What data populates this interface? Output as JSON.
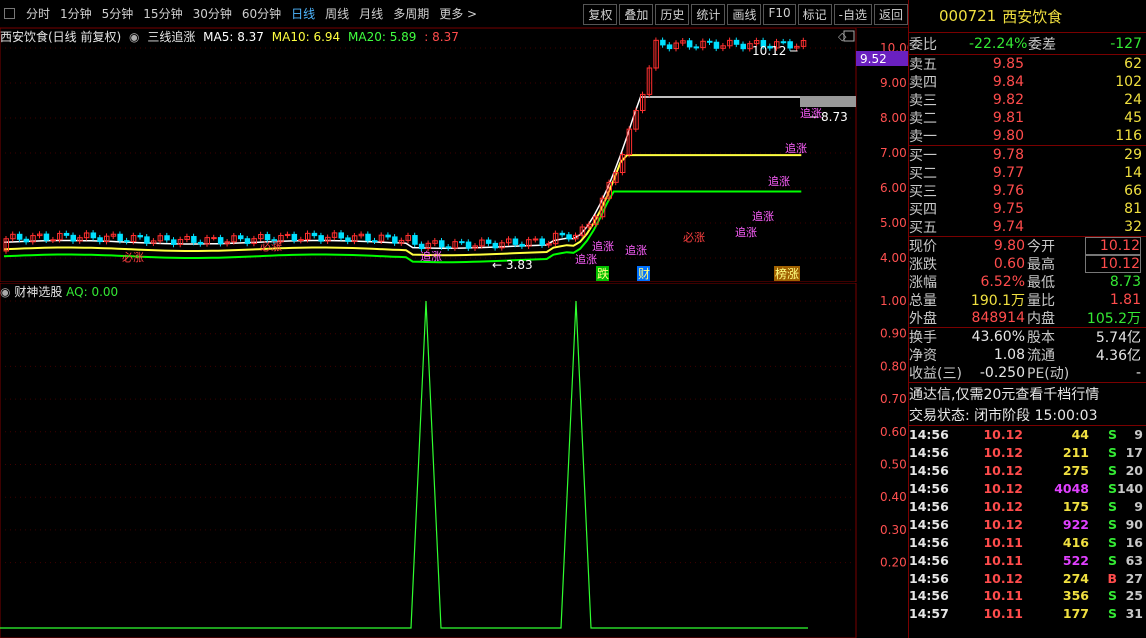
{
  "topbar": {
    "periods": [
      "分时",
      "1分钟",
      "5分钟",
      "15分钟",
      "30分钟",
      "60分钟",
      "日线",
      "周线",
      "月线",
      "多周期",
      "更多"
    ],
    "active": "日线",
    "buttons": [
      "复权",
      "叠加",
      "历史",
      "统计",
      "画线",
      "F10",
      "标记",
      "-自选",
      "返回"
    ]
  },
  "kline_header": {
    "stock": "西安饮食(日线 前复权)",
    "formula": "三线追涨",
    "ma5": "MA5: 8.37",
    "ma10": "MA10: 6.94",
    "ma20": "MA20: 5.89",
    "extra": ": 8.37"
  },
  "price_axis": [
    "10.00",
    "9.00",
    "8.00",
    "7.00",
    "6.00",
    "5.00",
    "4.00"
  ],
  "annotations": {
    "high": "10.12",
    "low": "3.83",
    "last": "8.73",
    "cursor_price": "9.52",
    "signal": "追涨",
    "signal2": "必涨",
    "markers": [
      "跌",
      "财",
      "榜涨"
    ]
  },
  "indicator_header": {
    "name": "财神选股",
    "value": "AQ: 0.00"
  },
  "indicator_axis": [
    "1.00",
    "0.90",
    "0.80",
    "0.70",
    "0.60",
    "0.50",
    "0.40",
    "0.30",
    "0.20"
  ],
  "quote": {
    "code": "000721",
    "name": "西安饮食",
    "weibi_label": "委比",
    "weibi": "-22.24%",
    "weicha_label": "委差",
    "weicha": "-127",
    "asks": [
      {
        "label": "卖五",
        "price": "9.85",
        "vol": "62"
      },
      {
        "label": "卖四",
        "price": "9.84",
        "vol": "102"
      },
      {
        "label": "卖三",
        "price": "9.82",
        "vol": "24"
      },
      {
        "label": "卖二",
        "price": "9.81",
        "vol": "45"
      },
      {
        "label": "卖一",
        "price": "9.80",
        "vol": "116"
      }
    ],
    "bids": [
      {
        "label": "买一",
        "price": "9.78",
        "vol": "29"
      },
      {
        "label": "买二",
        "price": "9.77",
        "vol": "14"
      },
      {
        "label": "买三",
        "price": "9.76",
        "vol": "66"
      },
      {
        "label": "买四",
        "price": "9.75",
        "vol": "81"
      },
      {
        "label": "买五",
        "price": "9.74",
        "vol": "32"
      }
    ],
    "stats": [
      [
        "现价",
        "9.80",
        "今开",
        "10.12"
      ],
      [
        "涨跌",
        "0.60",
        "最高",
        "10.12"
      ],
      [
        "涨幅",
        "6.52%",
        "最低",
        "8.73"
      ],
      [
        "总量",
        "190.1万",
        "量比",
        "1.81"
      ],
      [
        "外盘",
        "848914",
        "内盘",
        "105.2万"
      ]
    ],
    "stats2": [
      [
        "换手",
        "43.60%",
        "股本",
        "5.74亿"
      ],
      [
        "净资",
        "1.08",
        "流通",
        "4.36亿"
      ],
      [
        "收益(三)",
        "-0.250",
        "PE(动)",
        "-"
      ]
    ],
    "promo": "通达信,仅需20元查看千档行情",
    "status": "交易状态: 闭市阶段 15:00:03"
  },
  "ticks": [
    [
      "14:56",
      "10.12",
      "44",
      "S",
      "9"
    ],
    [
      "14:56",
      "10.12",
      "211",
      "S",
      "17"
    ],
    [
      "14:56",
      "10.12",
      "275",
      "S",
      "20"
    ],
    [
      "14:56",
      "10.12",
      "4048",
      "S",
      "140"
    ],
    [
      "14:56",
      "10.12",
      "175",
      "S",
      "9"
    ],
    [
      "14:56",
      "10.12",
      "922",
      "S",
      "90"
    ],
    [
      "14:56",
      "10.11",
      "416",
      "S",
      "16"
    ],
    [
      "14:56",
      "10.11",
      "522",
      "S",
      "63"
    ],
    [
      "14:56",
      "10.12",
      "274",
      "B",
      "27"
    ],
    [
      "14:56",
      "10.11",
      "356",
      "S",
      "25"
    ],
    [
      "14:57",
      "10.11",
      "177",
      "S",
      "31"
    ]
  ],
  "colors": {
    "up": "#ff3030",
    "down": "#00ffff",
    "ma5": "#ffffff",
    "ma10": "#ffff00",
    "ma20": "#00ff00",
    "frame": "#7a0000"
  }
}
